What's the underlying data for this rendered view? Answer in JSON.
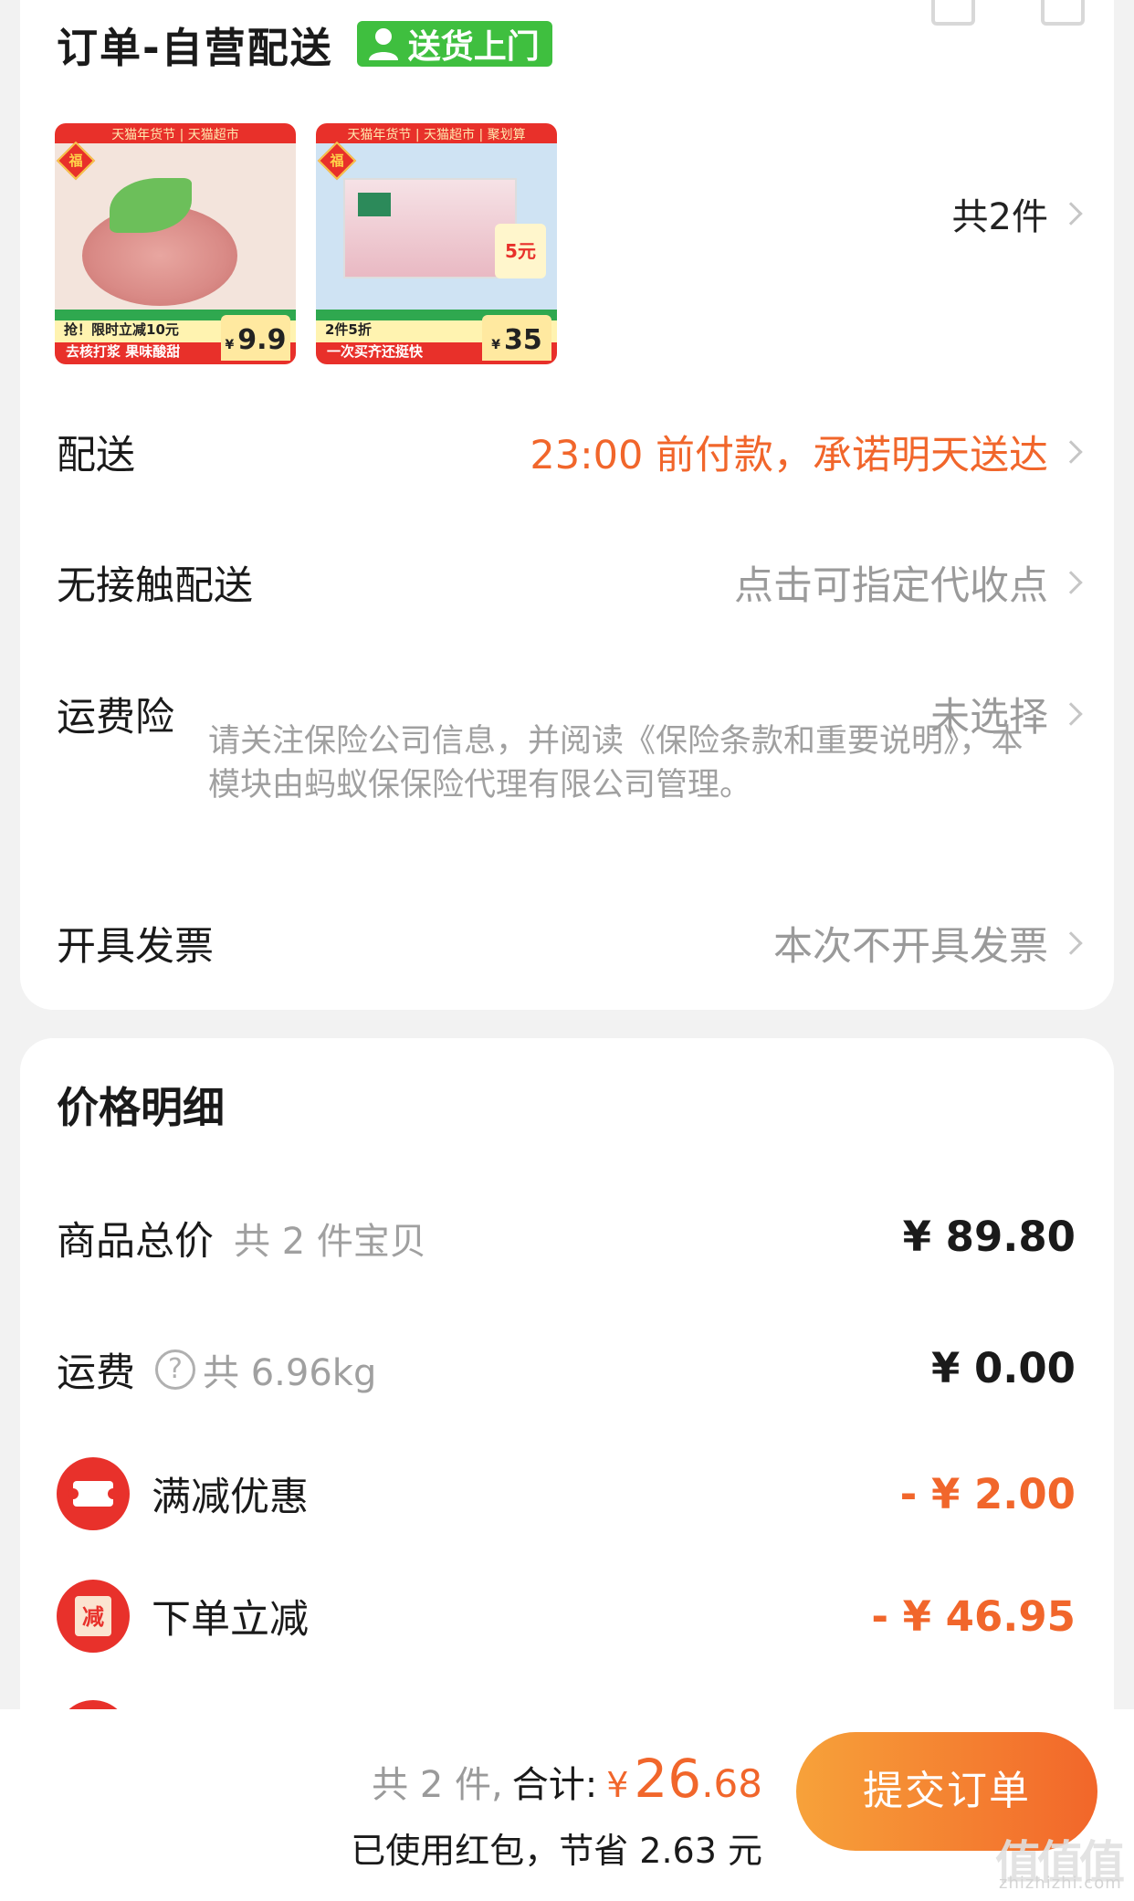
{
  "order": {
    "title": "订单-自营配送",
    "delivery_tag": "送货上门",
    "item_count": "共2件",
    "products": [
      {
        "top_banner": "天猫年货节 | 天猫超市",
        "promo_line": "抢！限时立减10元",
        "sub_line": "去核打浆 果味酸甜",
        "price": "9.9",
        "currency": "¥"
      },
      {
        "top_banner": "天猫年货节 | 天猫超市 | 聚划算",
        "promo_line": "2件5折",
        "sub_line": "一次买齐还挺快",
        "price": "35",
        "currency": "¥",
        "badge": "5元"
      }
    ]
  },
  "rows": {
    "delivery": {
      "label": "配送",
      "value": "23:00 前付款，承诺明天送达"
    },
    "contactless": {
      "label": "无接触配送",
      "value": "点击可指定代收点"
    },
    "shipping_insurance": {
      "label": "运费险",
      "value": "未选择",
      "note": "请关注保险公司信息，并阅读《保险条款和重要说明》，本模块由蚂蚁保保险代理有限公司管理。"
    },
    "invoice": {
      "label": "开具发票",
      "value": "本次不开具发票"
    }
  },
  "price_detail": {
    "title": "价格明细",
    "goods_total": {
      "label": "商品总价",
      "sub": "共 2 件宝贝",
      "amount": "¥ 89.80"
    },
    "shipping": {
      "label": "运费",
      "help": "?",
      "sub": "共 6.96kg",
      "amount": "¥ 0.00"
    },
    "full_reduction": {
      "label": "满减优惠",
      "amount": "- ¥ 2.00"
    },
    "order_discount": {
      "label": "下单立减",
      "icon_text": "减",
      "amount": "- ¥ 46.95"
    }
  },
  "bottom_bar": {
    "count": "共 2 件,",
    "total_label": "合计:",
    "yen": "¥",
    "total_int": "26",
    "total_dec": ".68",
    "saving": "已使用红包，节省 2.63 元",
    "submit": "提交订单"
  },
  "watermark": {
    "text": "值值值",
    "site": "zhizhizhi.com"
  },
  "colors": {
    "accent_orange": "#f1662b",
    "button_gradient_start": "#f7a23a",
    "tag_green": "#3fbf3f",
    "discount_red": "#e8312b"
  }
}
